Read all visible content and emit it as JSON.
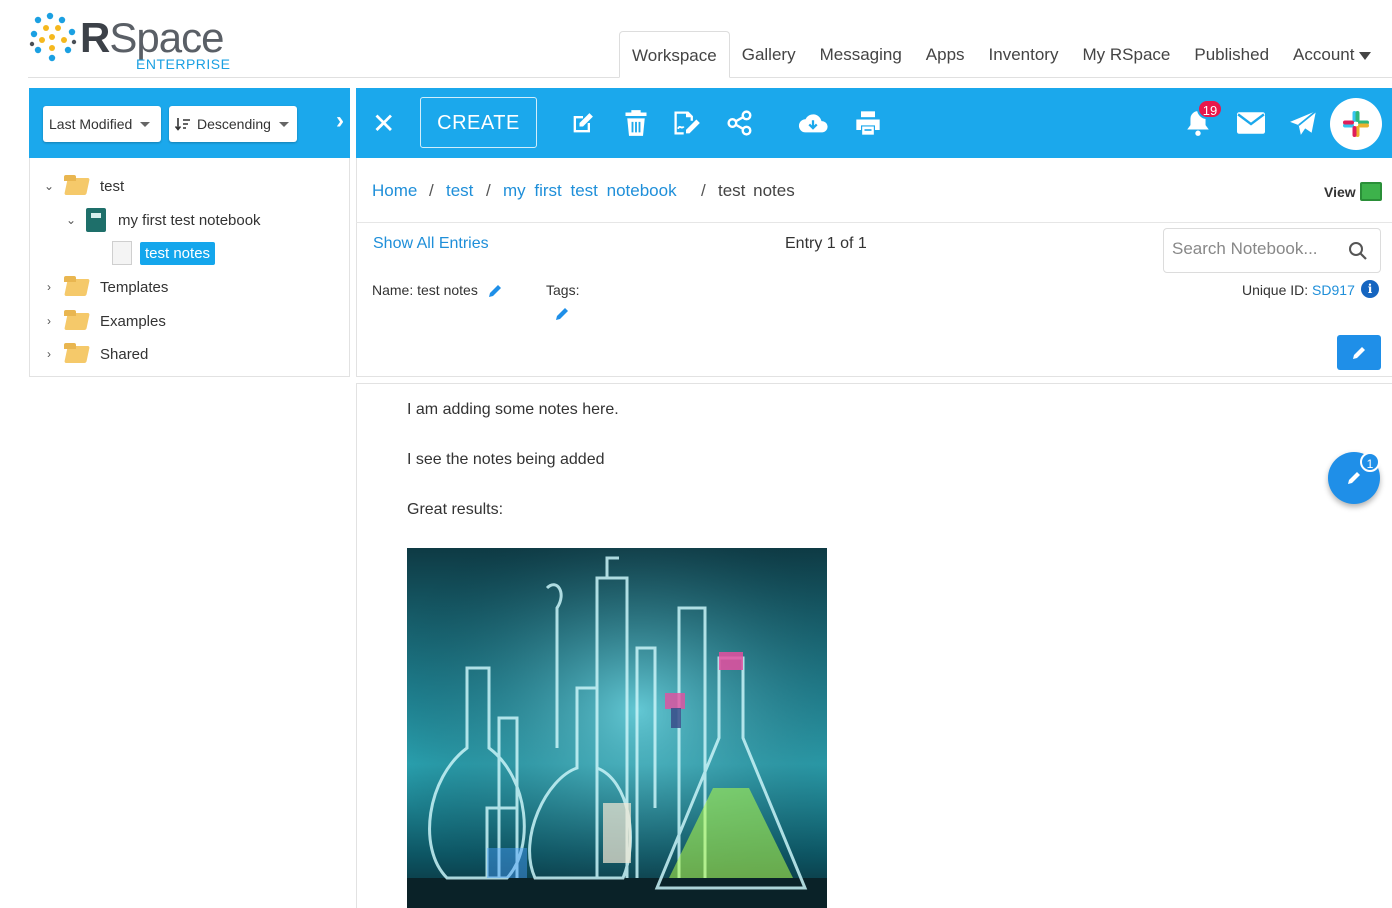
{
  "app": {
    "logo_main_r": "R",
    "logo_main_rest": "Space",
    "logo_sub": "ENTERPRISE"
  },
  "nav": {
    "tabs": [
      {
        "label": "Workspace"
      },
      {
        "label": "Gallery"
      },
      {
        "label": "Messaging"
      },
      {
        "label": "Apps"
      },
      {
        "label": "Inventory"
      },
      {
        "label": "My RSpace"
      },
      {
        "label": "Published"
      },
      {
        "label": "Account"
      }
    ],
    "active": "Workspace"
  },
  "sidebar": {
    "sort_field": "Last Modified",
    "sort_order": "Descending",
    "tree": [
      {
        "label": "test"
      },
      {
        "label": "my first test notebook"
      },
      {
        "label": "test notes"
      },
      {
        "label": "Templates"
      },
      {
        "label": "Examples"
      },
      {
        "label": "Shared"
      }
    ]
  },
  "toolbar": {
    "create_label": "CREATE",
    "close_glyph": "✕",
    "notification_count": "19",
    "accent_color": "#1ba8ec",
    "icons": [
      "edit-icon",
      "delete-icon",
      "sign-icon",
      "share-icon",
      "download-icon",
      "print-icon",
      "bell-icon",
      "mail-icon",
      "send-icon",
      "slack-icon"
    ]
  },
  "breadcrumb": {
    "items": [
      "Home",
      "test",
      "my first test notebook",
      "test notes"
    ],
    "separator": "/",
    "view_label": "View"
  },
  "entry": {
    "show_all_label": "Show All Entries",
    "entry_count": "Entry 1 of 1",
    "search_placeholder": "Search Notebook...",
    "name_label": "Name: test notes",
    "tags_label": "Tags:",
    "unique_id_label": "Unique ID:",
    "unique_id": "SD917",
    "info_glyph": "i"
  },
  "notes": {
    "lines": [
      "I am adding some notes here.",
      "I see the notes being added",
      "Great results:"
    ],
    "image_description": "lab-glassware-photo"
  },
  "fab": {
    "count": "1"
  }
}
